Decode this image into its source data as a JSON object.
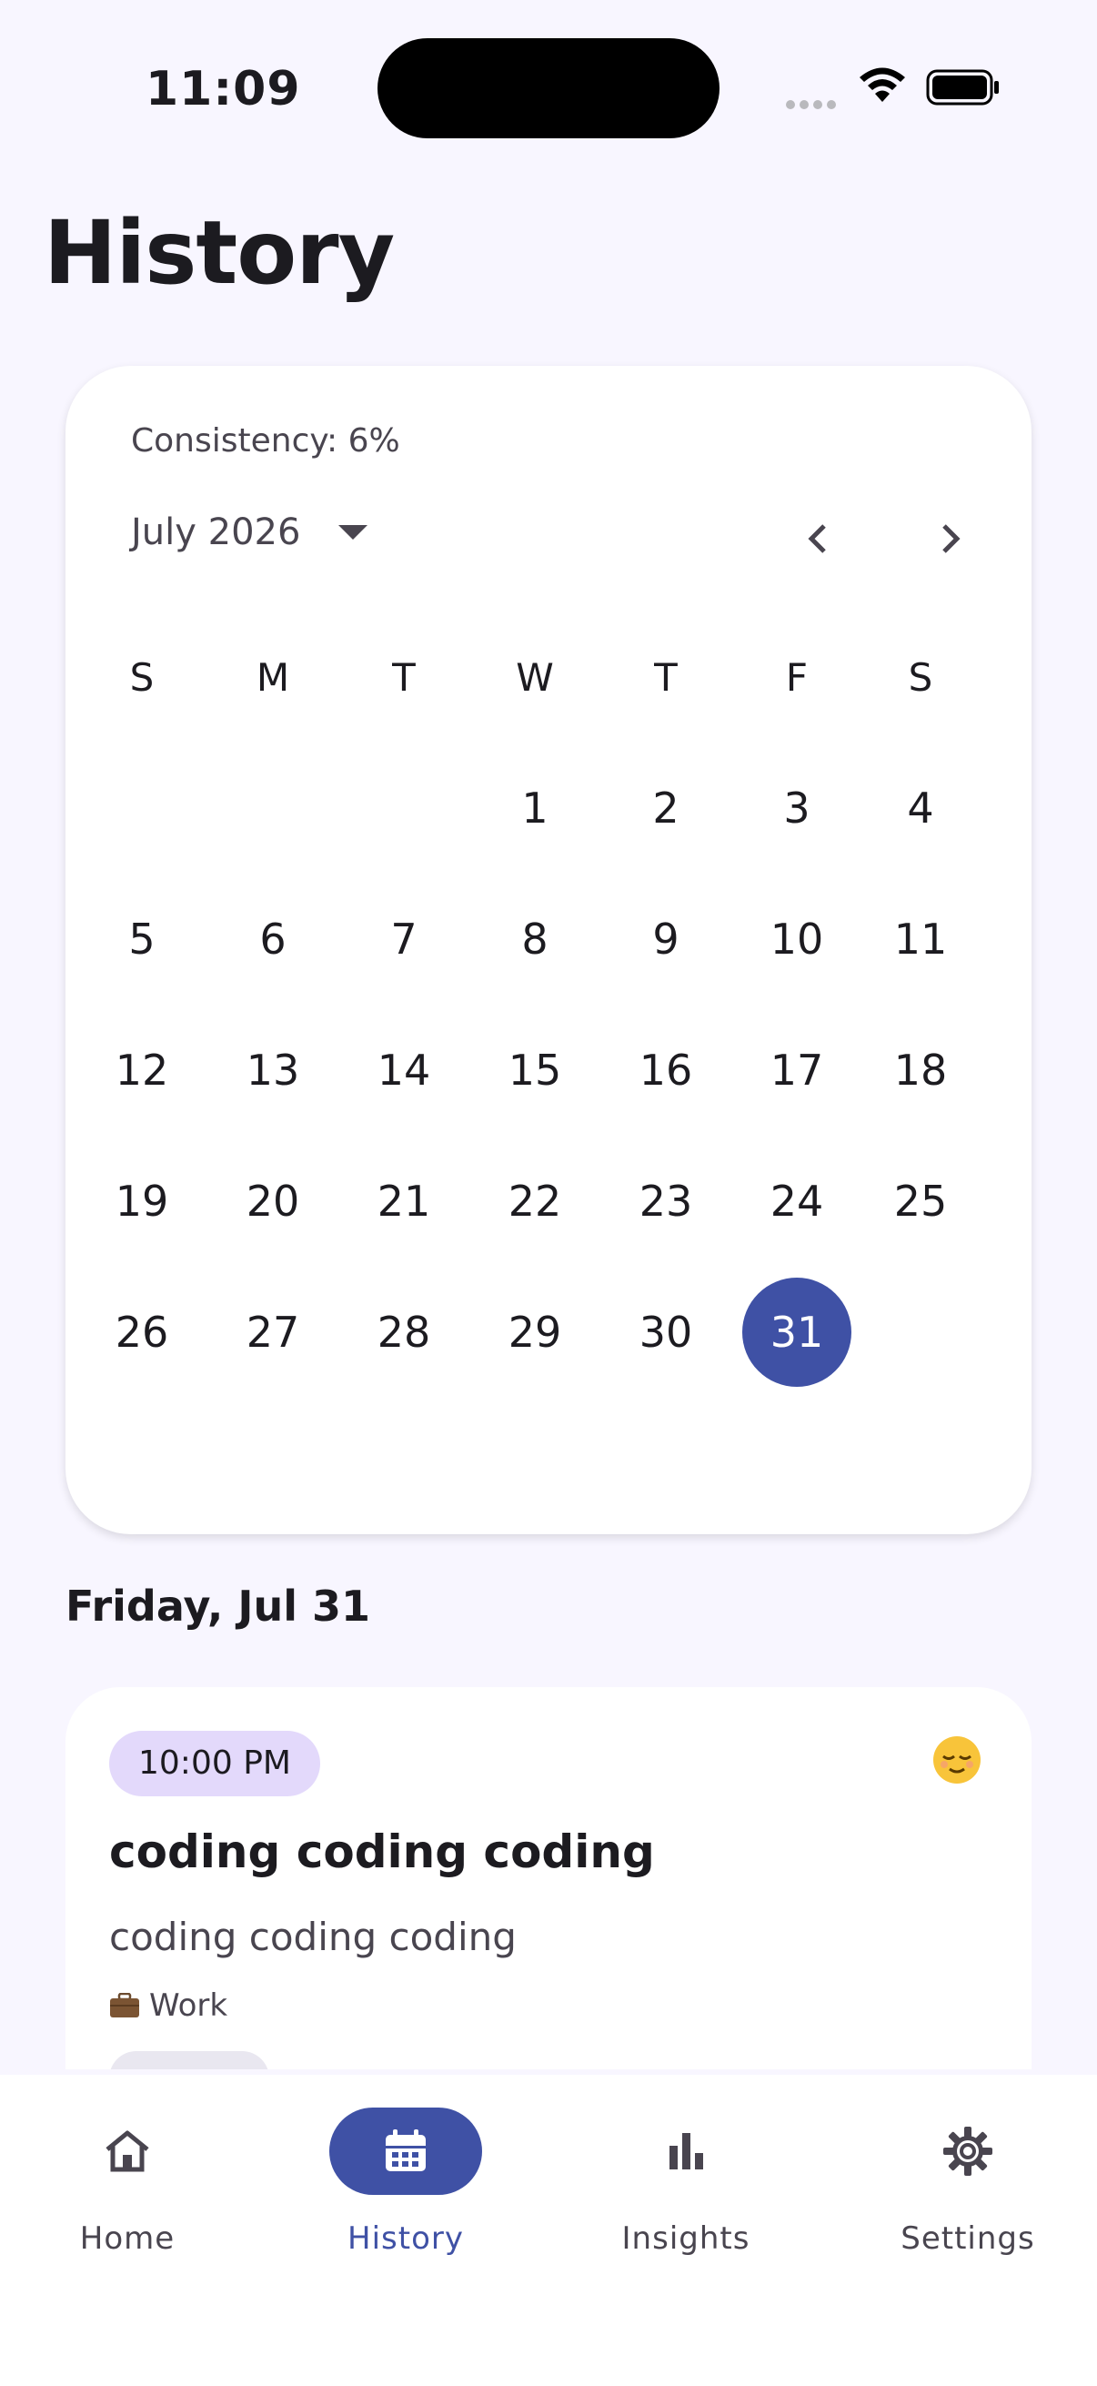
{
  "status_bar": {
    "time": "11:09"
  },
  "page": {
    "title": "History"
  },
  "calendar": {
    "consistency_label": "Consistency: 6%",
    "month_label": "July 2026",
    "weekdays": [
      "S",
      "M",
      "T",
      "W",
      "T",
      "F",
      "S"
    ],
    "weeks": [
      [
        "",
        "",
        "",
        "1",
        "2",
        "3",
        "4"
      ],
      [
        "5",
        "6",
        "7",
        "8",
        "9",
        "10",
        "11"
      ],
      [
        "12",
        "13",
        "14",
        "15",
        "16",
        "17",
        "18"
      ],
      [
        "19",
        "20",
        "21",
        "22",
        "23",
        "24",
        "25"
      ],
      [
        "26",
        "27",
        "28",
        "29",
        "30",
        "31",
        ""
      ]
    ],
    "selected_day": "31",
    "accent_color": "#3f51a5"
  },
  "selected_date_heading": "Friday, Jul 31",
  "entry": {
    "time": "10:00 PM",
    "mood_icon": "relieved-face-emoji",
    "title": "coding coding coding",
    "body": "coding coding coding",
    "category_icon": "briefcase-icon",
    "category": "Work"
  },
  "bottom_nav": {
    "items": [
      {
        "label": "Home",
        "icon": "home-icon"
      },
      {
        "label": "History",
        "icon": "calendar-icon"
      },
      {
        "label": "Insights",
        "icon": "bar-chart-icon"
      },
      {
        "label": "Settings",
        "icon": "gear-icon"
      }
    ],
    "active": "History"
  }
}
